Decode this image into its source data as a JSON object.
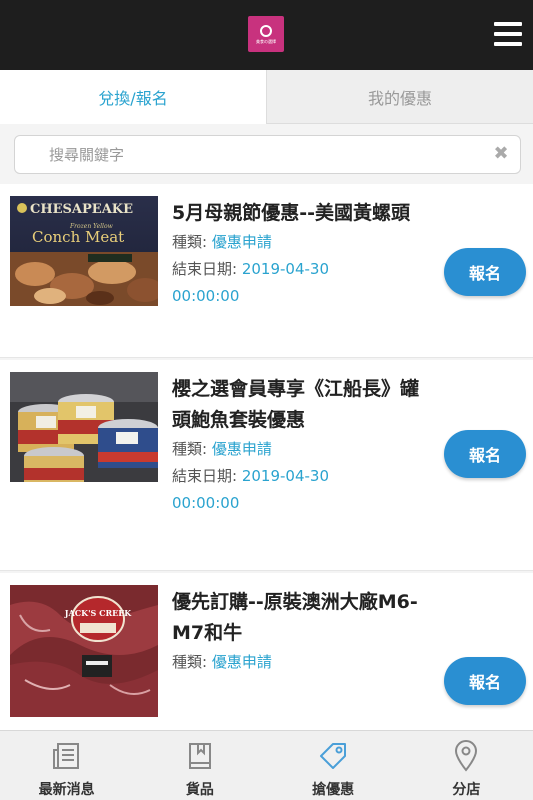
{
  "header": {
    "logo_text": "美食の選擇",
    "menu_icon": "hamburger-menu-icon"
  },
  "tabs": [
    {
      "label": "兌換/報名",
      "active": true
    },
    {
      "label": "我的優惠",
      "active": false
    }
  ],
  "search": {
    "placeholder": "搜尋關鍵字",
    "value": "",
    "clear_icon": "close-icon"
  },
  "offers": [
    {
      "title": "5月母親節優惠--美國黃螺頭",
      "category_label": "種類:",
      "category_value": "優惠申請",
      "end_label": "結束日期:",
      "end_date": "2019-04-30",
      "end_time": "00:00:00",
      "button": "報名",
      "image_brand": "CHESAPEAKE",
      "image_subtitle": "Frozen Yellow",
      "image_product": "Conch Meat"
    },
    {
      "title": "櫻之選會員專享《江船長》罐頭鮑魚套裝優惠",
      "category_label": "種類:",
      "category_value": "優惠申請",
      "end_label": "結束日期:",
      "end_date": "2019-04-30",
      "end_time": "00:00:00",
      "button": "報名"
    },
    {
      "title": "優先訂購--原裝澳洲大廠M6-M7和牛",
      "category_label": "種類:",
      "category_value": "優惠申請",
      "button": "報名",
      "image_brand": "JACK'S CREEK"
    }
  ],
  "bottom_nav": [
    {
      "label": "最新消息",
      "icon": "newspaper-icon"
    },
    {
      "label": "貨品",
      "icon": "book-icon"
    },
    {
      "label": "搶優惠",
      "icon": "tag-icon",
      "active": true
    },
    {
      "label": "分店",
      "icon": "location-pin-icon"
    }
  ],
  "colors": {
    "accent": "#2aa3cf",
    "button": "#2a8fd2",
    "header_bg": "#1e1e1e",
    "logo_bg": "#c8327e",
    "tag_active": "#4a9fd8"
  }
}
